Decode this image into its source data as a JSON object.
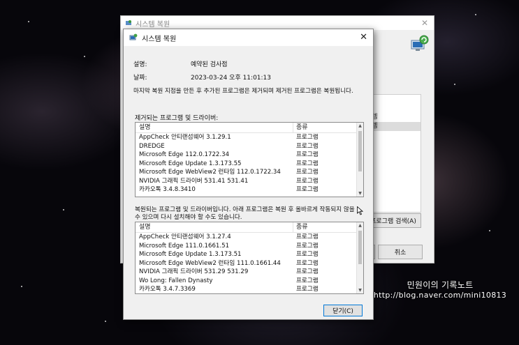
{
  "background_window": {
    "title": "시스템 복원",
    "list_items": [
      "",
      "",
      "",
      "",
      "",
      ""
    ],
    "list_partials": [
      "르",
      "정",
      "스템",
      "스템"
    ],
    "scan_button": "프로그램 검색(A)",
    "cancel_button": "취소",
    "next_button": ""
  },
  "dialog": {
    "title": "시스템 복원",
    "description_label": "설명:",
    "description_value": "예약된 검사점",
    "date_label": "날짜:",
    "date_value": "2023-03-24 오후 11:01:13",
    "info_text": "마지막 복원 지점을 만든 후 추가된 프로그램은 제거되며 제거된 프로그램은 복원됩니다.",
    "removed_section_label": "제거되는 프로그램 및 드라이버:",
    "restored_section_label_line1": "복원되는 프로그램 및 드라이버입니다. 아래 프로그램은 복원 후 올바르게 작동되지 않을",
    "restored_section_label_line2": "수 있으며 다시 설치해야 할 수도 있습니다.",
    "col_description": "설명",
    "col_type": "종류",
    "removed_items": [
      {
        "name": "AppCheck 안티랜섬웨어 3.1.29.1",
        "type": "프로그램"
      },
      {
        "name": "DREDGE",
        "type": "프로그램"
      },
      {
        "name": "Microsoft Edge 112.0.1722.34",
        "type": "프로그램"
      },
      {
        "name": "Microsoft Edge Update 1.3.173.55",
        "type": "프로그램"
      },
      {
        "name": "Microsoft Edge WebView2 런타임 112.0.1722.34",
        "type": "프로그램"
      },
      {
        "name": "NVIDIA 그래픽 드라이버 531.41 531.41",
        "type": "프로그램"
      },
      {
        "name": "카카오톡 3.4.8.3410",
        "type": "프로그램"
      }
    ],
    "restored_items": [
      {
        "name": "AppCheck 안티랜섬웨어 3.1.27.4",
        "type": "프로그램"
      },
      {
        "name": "Microsoft Edge 111.0.1661.51",
        "type": "프로그램"
      },
      {
        "name": "Microsoft Edge Update 1.3.173.51",
        "type": "프로그램"
      },
      {
        "name": "Microsoft Edge WebView2 런타임 111.0.1661.44",
        "type": "프로그램"
      },
      {
        "name": "NVIDIA 그래픽 드라이버 531.29 531.29",
        "type": "프로그램"
      },
      {
        "name": "Wo Long: Fallen Dynasty",
        "type": "프로그램"
      },
      {
        "name": "카카오톡 3.4.7.3369",
        "type": "프로그램"
      }
    ],
    "close_button": "닫기(C)"
  },
  "watermark": {
    "line1": "민원이의 기록노트",
    "line2": "http://blog.naver.com/mini10813"
  },
  "colors": {
    "focus_border": "#0078d7",
    "dialog_bg": "#f0f0f0"
  },
  "icons": [
    "system-restore-icon",
    "close-icon",
    "scroll-up-icon",
    "scroll-down-icon",
    "mouse-cursor-icon"
  ]
}
